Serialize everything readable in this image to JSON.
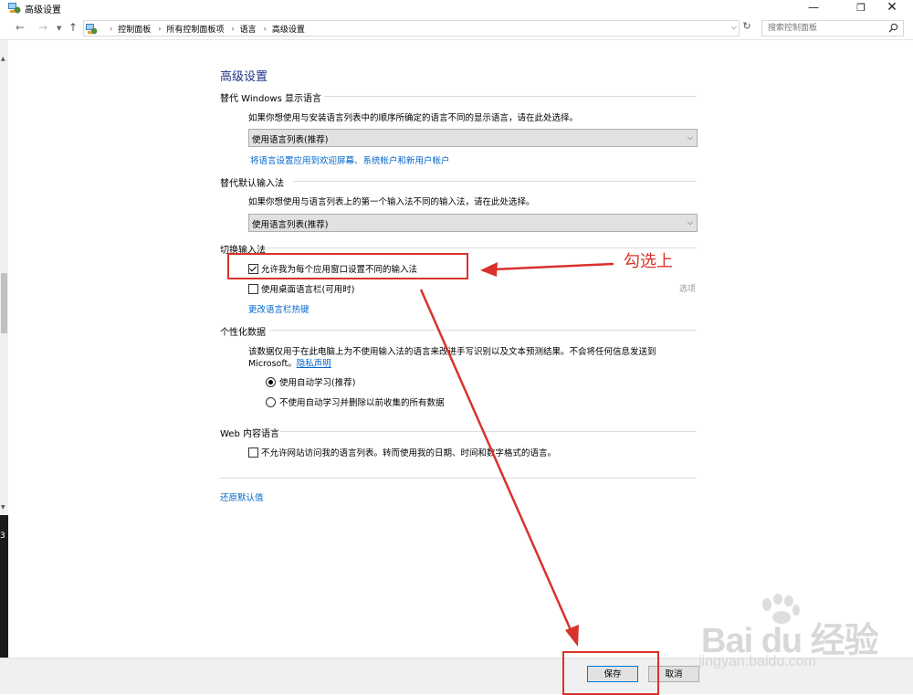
{
  "window": {
    "title": "高级设置"
  },
  "address": {
    "breadcrumbs": [
      "控制面板",
      "所有控制面板项",
      "语言",
      "高级设置"
    ],
    "search_placeholder": "搜索控制面板"
  },
  "page": {
    "heading": "高级设置",
    "display_language": {
      "title": "替代 Windows 显示语言",
      "description": "如果你想使用与安装语言列表中的顺序所确定的语言不同的显示语言，请在此处选择。",
      "select_value": "使用语言列表(推荐)",
      "link": "将语言设置应用到欢迎屏幕、系统帐户和新用户帐户"
    },
    "default_input": {
      "title": "替代默认输入法",
      "description": "如果你想使用与语言列表上的第一个输入法不同的输入法，请在此处选择。",
      "select_value": "使用语言列表(推荐)"
    },
    "switch_input": {
      "title": "切换输入法",
      "per_app_label": "允许我为每个应用窗口设置不同的输入法",
      "per_app_checked": true,
      "desktop_bar_label": "使用桌面语言栏(可用时)",
      "desktop_bar_checked": false,
      "options_label": "选项",
      "hotkey_link": "更改语言栏热键"
    },
    "personalization": {
      "title": "个性化数据",
      "description_line1": "该数据仅用于在此电脑上为不使用输入法的语言来改进手写识别以及文本预测结果。不会将任何信息发送到",
      "description_line2_prefix": "Microsoft。",
      "privacy_link": "隐私声明",
      "radio_auto": "使用自动学习(推荐)",
      "radio_no_auto": "不使用自动学习并删除以前收集的所有数据",
      "selected": "auto"
    },
    "web_content": {
      "title": "Web 内容语言",
      "checkbox_label": "不允许网站访问我的语言列表。转而使用我的日期、时间和数字格式的语言。",
      "checked": false
    },
    "restore_link": "还原默认值"
  },
  "footer": {
    "save_label": "保存",
    "cancel_label": "取消"
  },
  "annotation": {
    "text": "勾选上",
    "color": "#d9322b"
  },
  "watermark": {
    "brand": "Bai du 经验",
    "url": "jingyan.baidu.com"
  },
  "left_strip": {
    "text": "3"
  }
}
